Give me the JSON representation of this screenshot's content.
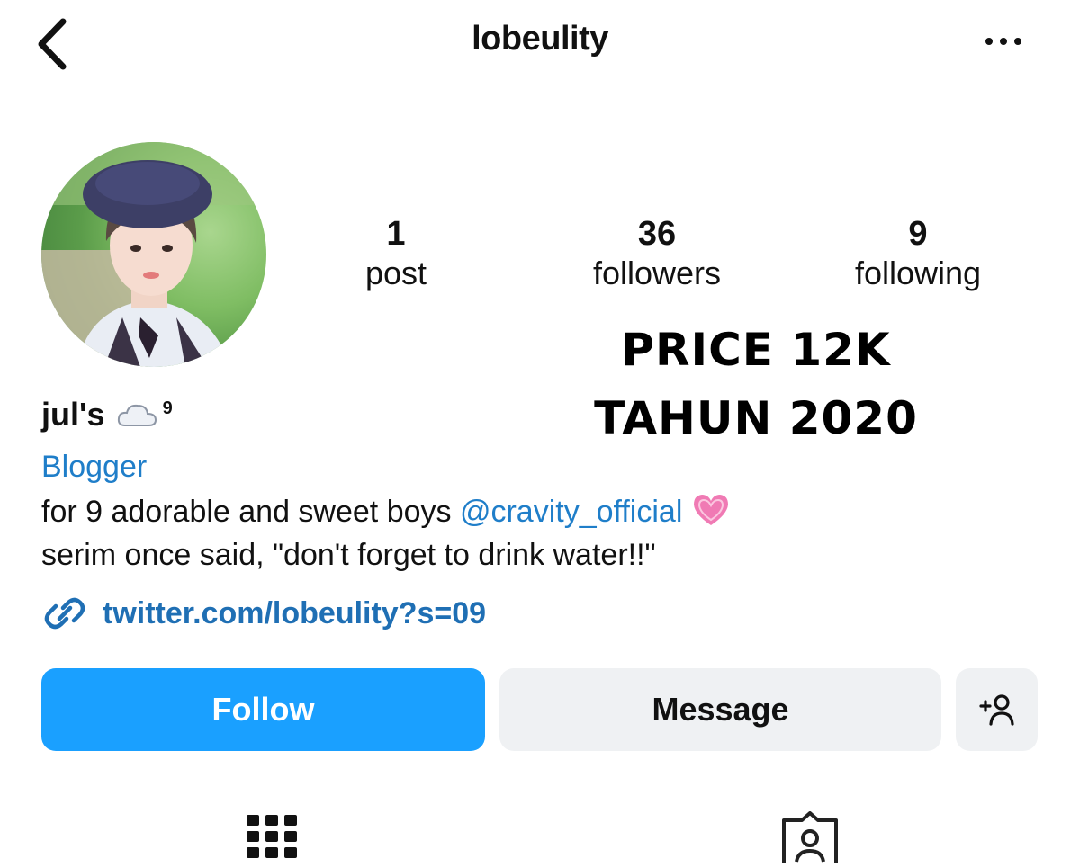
{
  "header": {
    "username": "lobeulity"
  },
  "stats": {
    "posts": {
      "value": "1",
      "label": "post"
    },
    "followers": {
      "value": "36",
      "label": "followers"
    },
    "following": {
      "value": "9",
      "label": "following"
    }
  },
  "overlay": {
    "line1": "PRICE 12K",
    "line2": "TAHUN 2020"
  },
  "profile": {
    "display_name": "jul's",
    "name_suffix": "9",
    "category": "Blogger",
    "bio_line1_text": "for 9 adorable and sweet boys ",
    "bio_mention": "@cravity_official",
    "bio_line2": "serim once said,  \"don't forget to drink water!!\"",
    "link": "twitter.com/lobeulity?s=09"
  },
  "actions": {
    "follow_label": "Follow",
    "message_label": "Message"
  },
  "colors": {
    "accent_blue": "#1aa0ff",
    "link_blue": "#1f7ec9",
    "secondary_bg": "#eff1f3"
  },
  "icons": [
    "back-chevron-icon",
    "more-options-icon",
    "cloud-icon",
    "heart-icon",
    "link-icon",
    "add-user-icon",
    "grid-icon",
    "tagged-icon"
  ]
}
